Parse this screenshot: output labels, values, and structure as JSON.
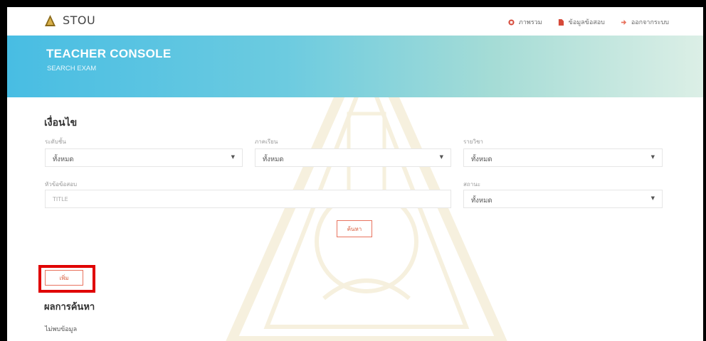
{
  "header": {
    "brand": "STOU",
    "nav": [
      {
        "label": "ภาพรวม",
        "icon": "dashboard-icon"
      },
      {
        "label": "ข้อมูลข้อสอบ",
        "icon": "document-icon"
      },
      {
        "label": "ออกจากระบบ",
        "icon": "logout-icon"
      }
    ]
  },
  "banner": {
    "title": "TEACHER CONSOLE",
    "subtitle": "SEARCH EXAM"
  },
  "filters": {
    "title": "เงื่อนไข",
    "level": {
      "label": "ระดับชั้น",
      "value": "ทั้งหมด"
    },
    "semester": {
      "label": "ภาคเรียน",
      "value": "ทั้งหมด"
    },
    "subject": {
      "label": "รายวิชา",
      "value": "ทั้งหมด"
    },
    "exam_title": {
      "label": "หัวข้อข้อสอบ",
      "placeholder": "TITLE"
    },
    "status": {
      "label": "สถานะ",
      "value": "ทั้งหมด"
    },
    "search_button": "ค้นหา"
  },
  "actions": {
    "add_button": "เพิ่ม"
  },
  "results": {
    "title": "ผลการค้นหา",
    "empty_text": "ไม่พบข้อมูล"
  },
  "colors": {
    "accent": "#e8735e",
    "banner_start": "#48bde3",
    "highlight": "#e00000"
  }
}
